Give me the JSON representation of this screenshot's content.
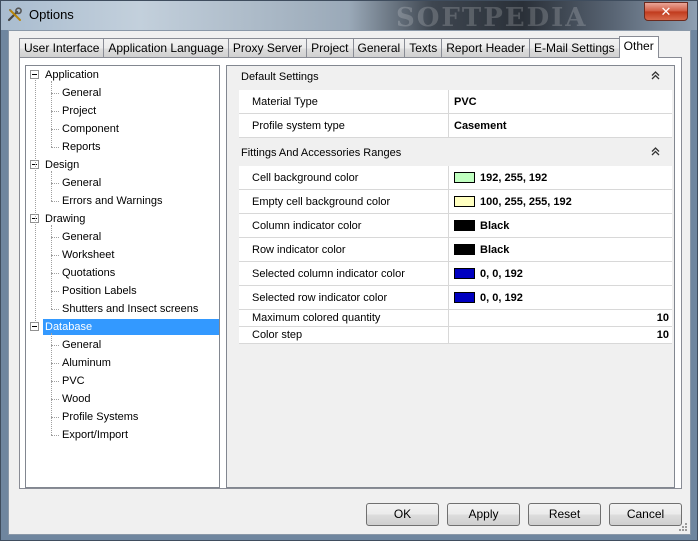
{
  "window": {
    "title": "Options",
    "watermark": "SOFTPEDIA",
    "close_label": "✕"
  },
  "tabs": [
    {
      "label": "User Interface",
      "active": false
    },
    {
      "label": "Application Language",
      "active": false
    },
    {
      "label": "Proxy Server",
      "active": false
    },
    {
      "label": "Project",
      "active": false
    },
    {
      "label": "General",
      "active": false
    },
    {
      "label": "Texts",
      "active": false
    },
    {
      "label": "Report Header",
      "active": false
    },
    {
      "label": "E-Mail Settings",
      "active": false
    },
    {
      "label": "Other",
      "active": true
    }
  ],
  "tree": {
    "groups": [
      {
        "label": "Application",
        "children": [
          "General",
          "Project",
          "Component",
          "Reports"
        ]
      },
      {
        "label": "Design",
        "children": [
          "General",
          "Errors and Warnings"
        ]
      },
      {
        "label": "Drawing",
        "children": [
          "General",
          "Worksheet",
          "Quotations",
          "Position Labels",
          "Shutters and Insect screens"
        ]
      },
      {
        "label": "Database",
        "selected": true,
        "children": [
          "General",
          "Aluminum",
          "PVC",
          "Wood",
          "Profile Systems",
          "Export/Import"
        ]
      }
    ]
  },
  "grid": {
    "categories": [
      {
        "label": "Default Settings",
        "rows": [
          {
            "name": "Material Type",
            "value": "PVC"
          },
          {
            "name": "Profile system type",
            "value": "Casement"
          }
        ]
      },
      {
        "label": "Fittings And Accessories Ranges",
        "rows": [
          {
            "name": "Cell background color",
            "value": "192, 255, 192",
            "swatch": "#c0ffc0"
          },
          {
            "name": "Empty cell background color",
            "value": "100, 255, 255, 192",
            "swatch": "#ffffc0"
          },
          {
            "name": "Column indicator color",
            "value": "Black",
            "swatch": "#000000"
          },
          {
            "name": "Row indicator color",
            "value": "Black",
            "swatch": "#000000"
          },
          {
            "name": "Selected column indicator color",
            "value": "0, 0, 192",
            "swatch": "#0000c0"
          },
          {
            "name": "Selected row indicator color",
            "value": "0, 0, 192",
            "swatch": "#0000c0"
          },
          {
            "name": "Maximum colored quantity",
            "value": "10",
            "numeric": true
          },
          {
            "name": "Color step",
            "value": "10",
            "numeric": true
          }
        ]
      }
    ]
  },
  "buttons": {
    "ok": "OK",
    "apply": "Apply",
    "reset": "Reset",
    "cancel": "Cancel"
  },
  "icons": {
    "title": "tools-icon",
    "collapse": "double-chevron-up-icon",
    "expander": "tree-collapse-icon"
  },
  "colors": {
    "selection": "#3399ff"
  }
}
